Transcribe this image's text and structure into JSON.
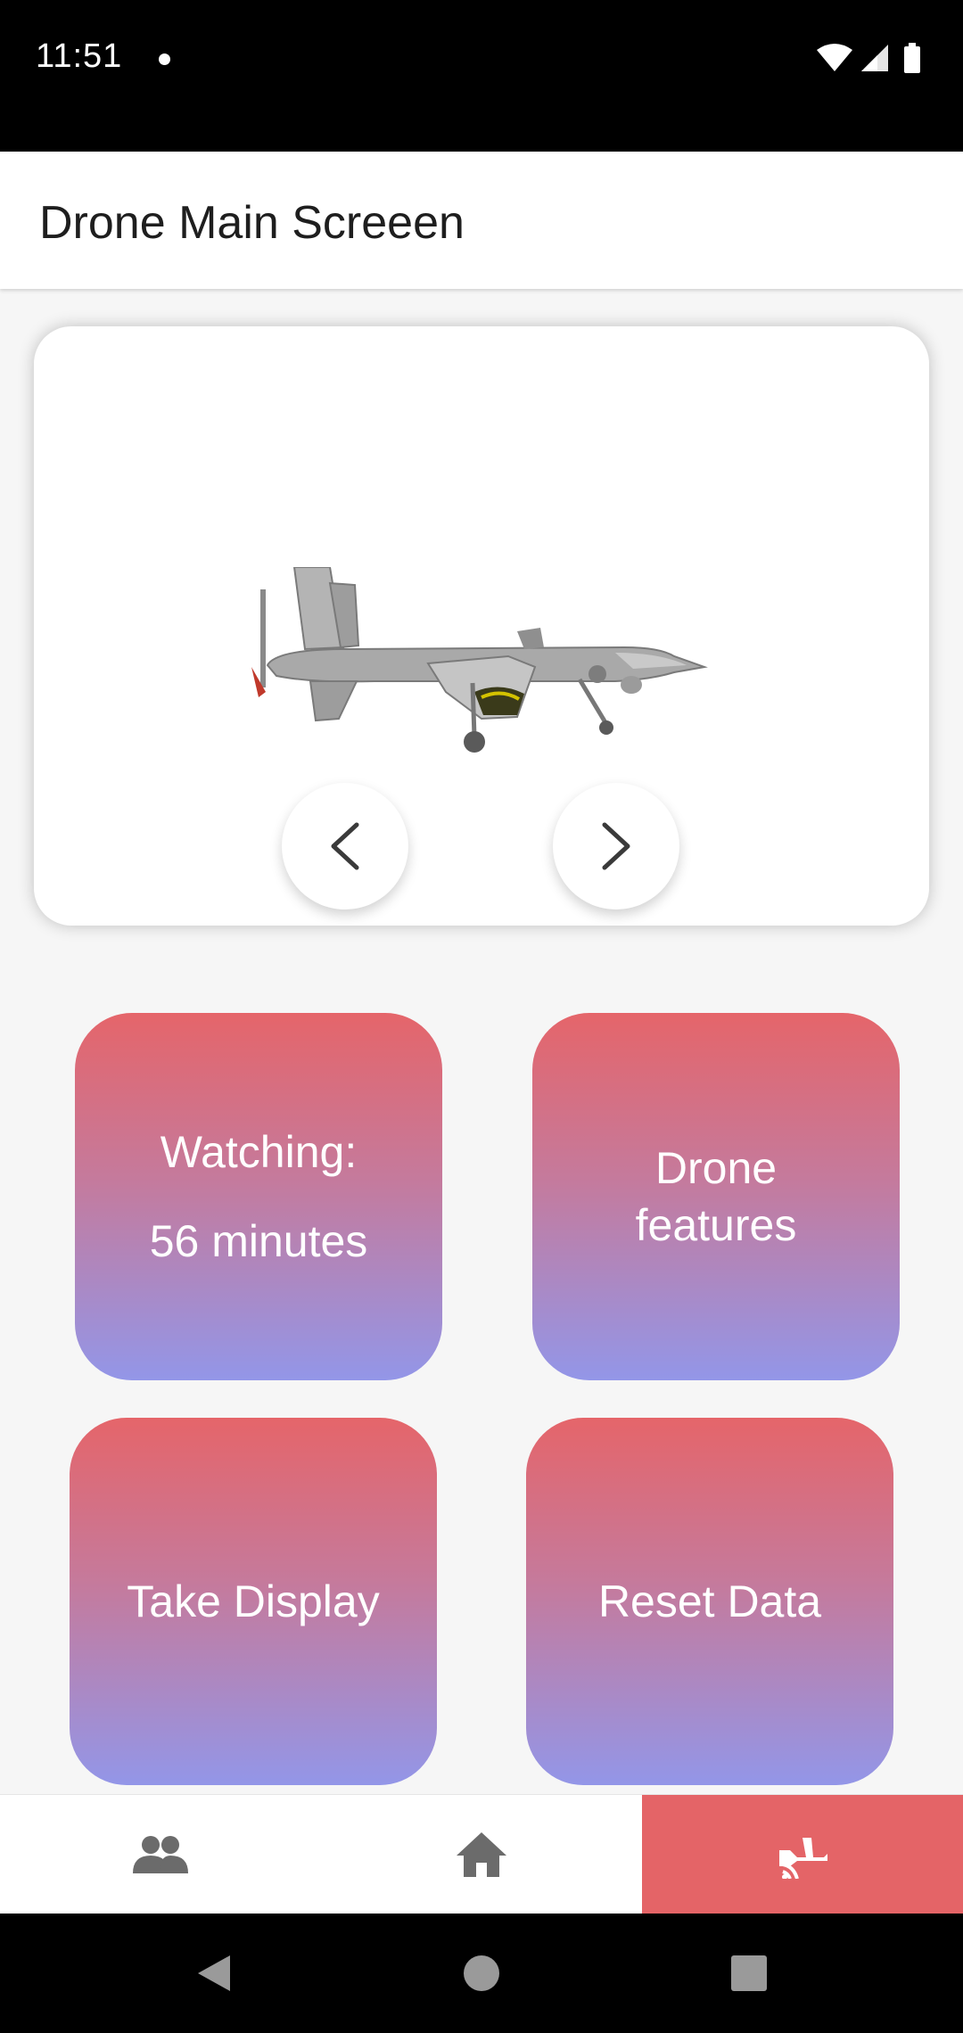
{
  "status_bar": {
    "time": "11:51"
  },
  "app_bar": {
    "title": "Drone Main Screeen"
  },
  "carousel": {
    "image_icon": "drone-image",
    "prev_icon": "chevron-left-icon",
    "next_icon": "chevron-right-icon"
  },
  "tiles": {
    "watching_label": "Watching:",
    "watching_value": "56 minutes",
    "features_line1": "Drone",
    "features_line2": "features",
    "display_label": "Take Display",
    "reset_label": "Reset Data"
  },
  "bottom_nav": {
    "items": [
      "people-icon",
      "home-icon",
      "drone-icon"
    ],
    "active_color": "#e46467"
  },
  "colors": {
    "gradient_top": "#e5656a",
    "gradient_bottom": "#9396e8"
  }
}
